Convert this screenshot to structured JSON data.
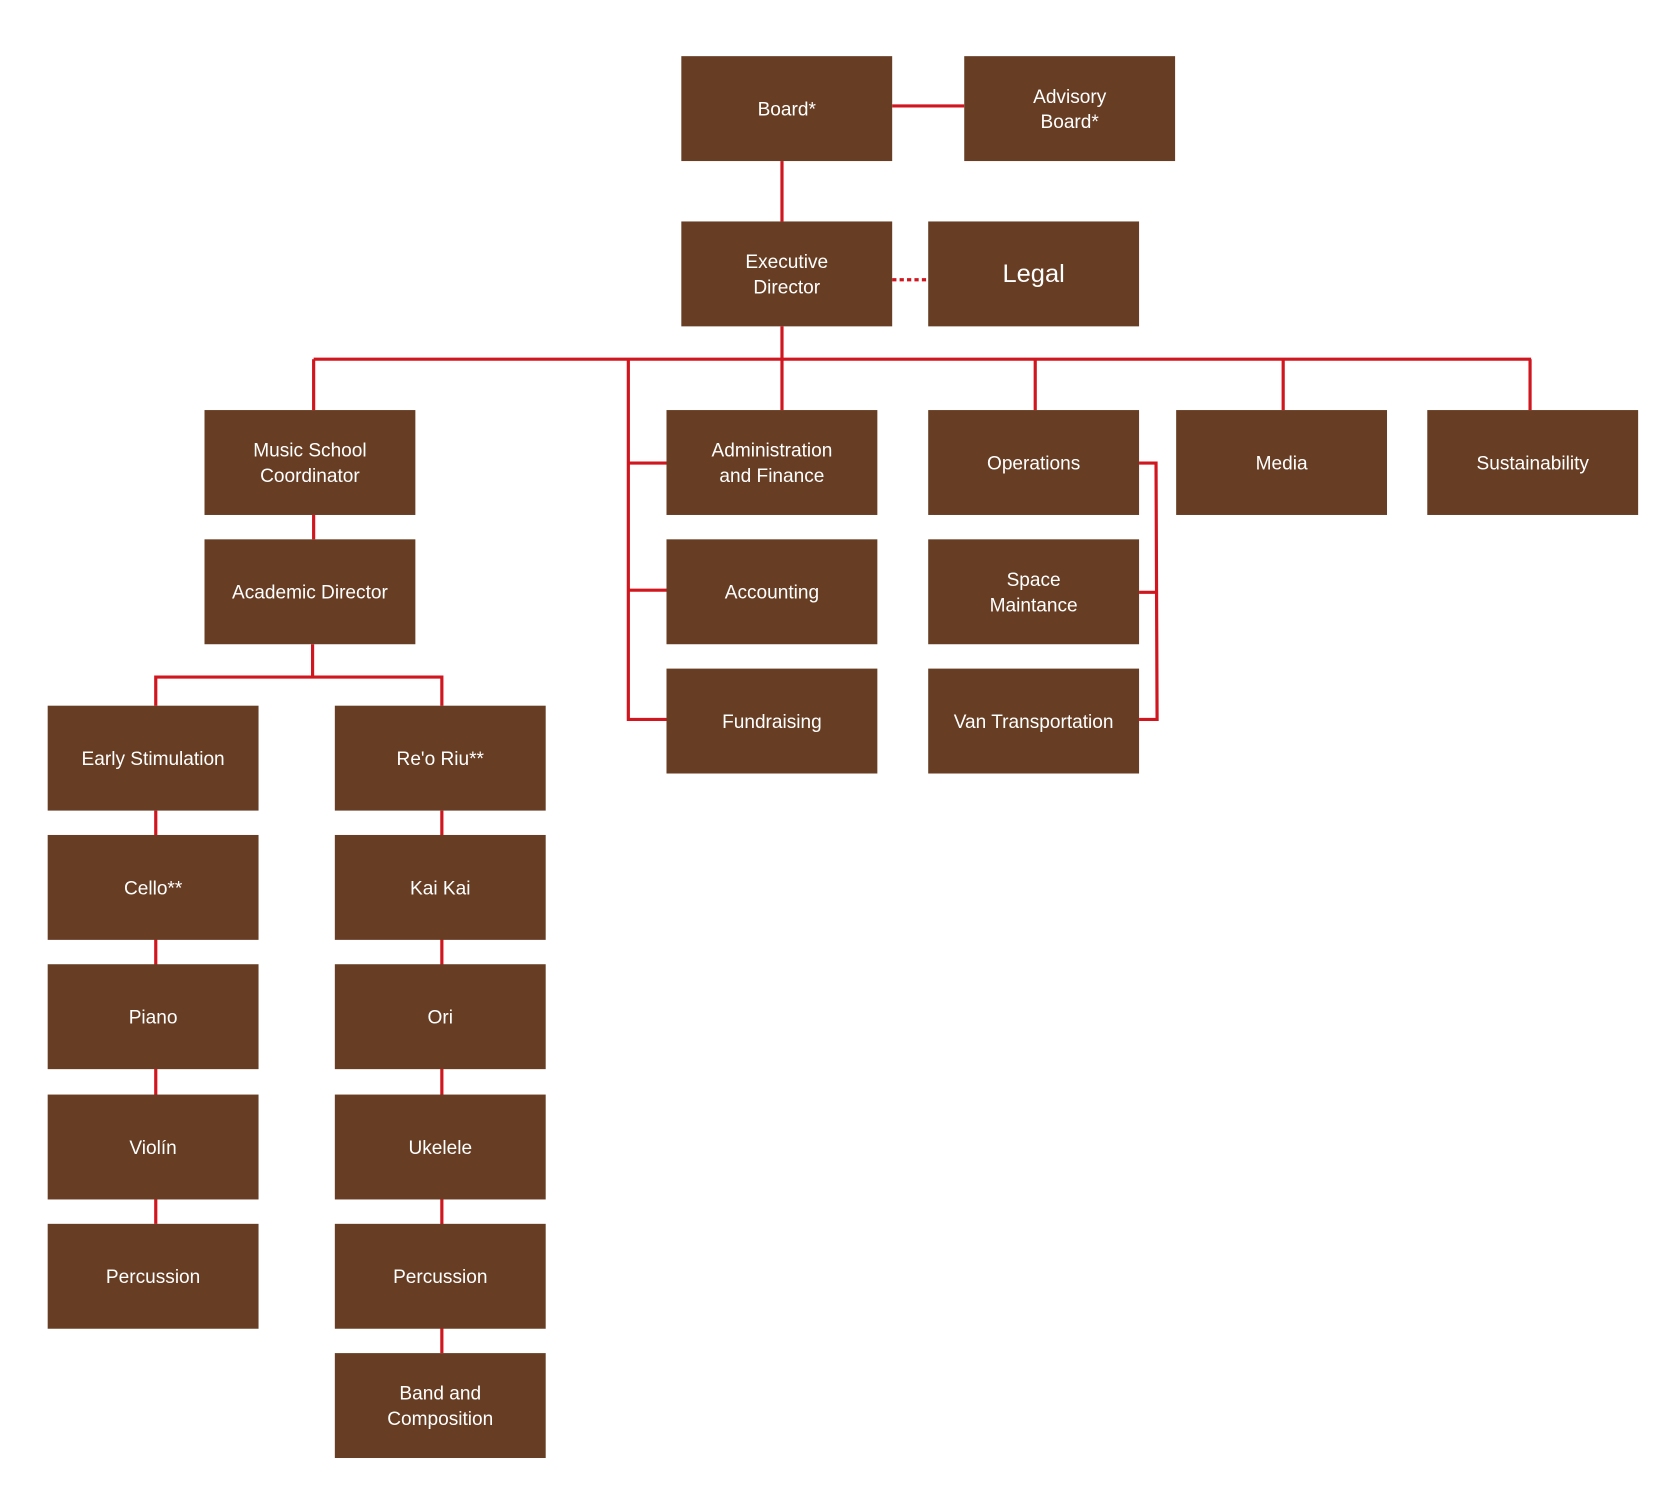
{
  "colors": {
    "box": "#673d23",
    "line": "#d0161e",
    "text": "#ffffff"
  },
  "nodes": {
    "board": "Board*",
    "advisory_board": "Advisory\nBoard*",
    "executive_director": "Executive\nDirector",
    "legal": "Legal",
    "music_school_coordinator": "Music School\nCoordinator",
    "academic_director": "Academic Director",
    "administration_finance": "Administration\nand Finance",
    "accounting": "Accounting",
    "fundraising": "Fundraising",
    "operations": "Operations",
    "space_maintance": "Space\nMaintance",
    "van_transportation": "Van Transportation",
    "media": "Media",
    "sustainability": "Sustainability",
    "early_stimulation": "Early Stimulation",
    "cello": "Cello**",
    "piano": "Piano",
    "violin": "Violín",
    "percussion_left": "Percussion",
    "reo_riu": "Re'o Riu**",
    "kai_kai": "Kai Kai",
    "ori": "Ori",
    "ukelele": "Ukelele",
    "percussion_right": "Percussion",
    "band_composition": "Band and\nComposition"
  }
}
